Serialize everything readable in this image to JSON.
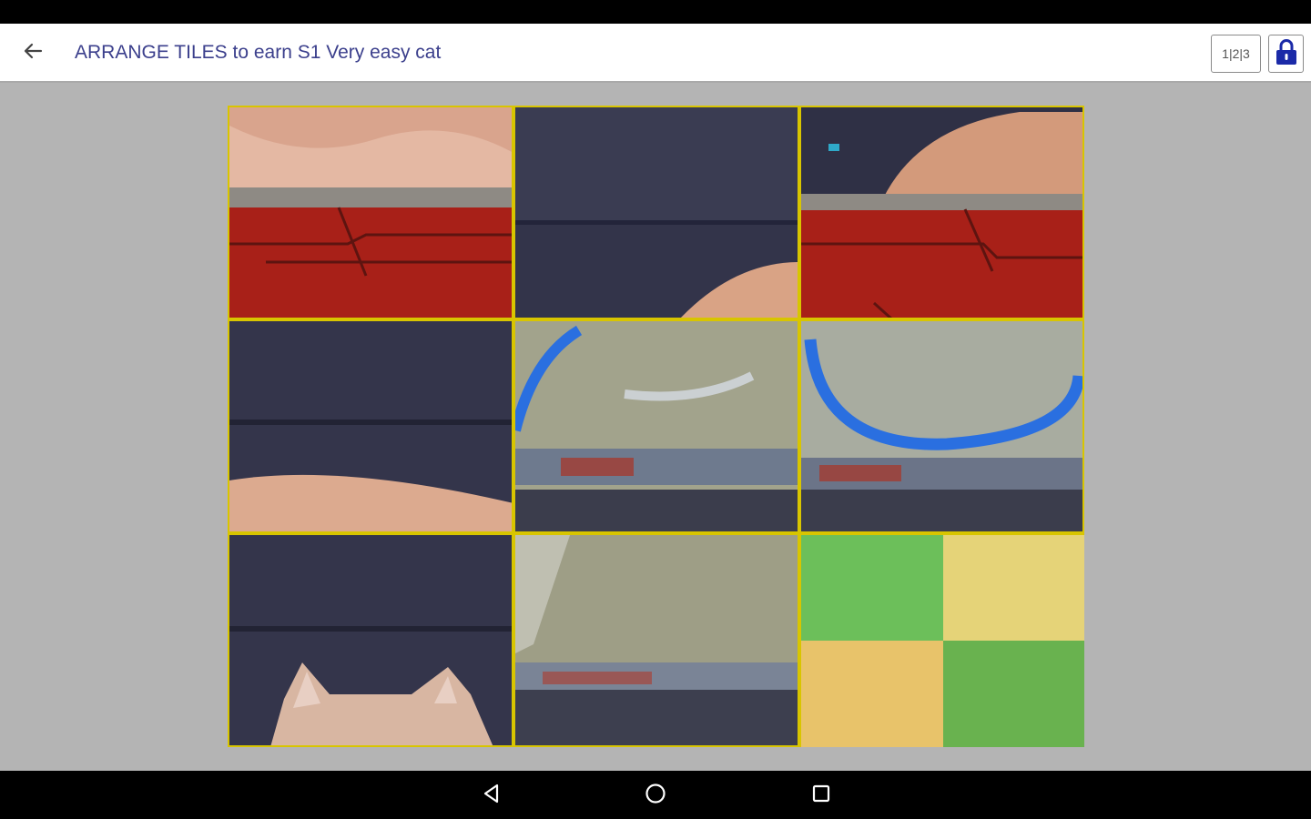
{
  "app_bar": {
    "title": "ARRANGE TILES to earn S1 Very easy cat",
    "mode_label": "1|2|3",
    "back_icon": "arrow-left-icon",
    "lock_icon": "lock-icon"
  },
  "colors": {
    "title_text": "#3b3f8c",
    "board_border": "#d8c500",
    "background": "#b4b4b4",
    "lock_accent": "#1b2aa8"
  },
  "board": {
    "rows": 3,
    "cols": 3,
    "tiles": [
      {
        "content": "cat-fur-on-red-brick"
      },
      {
        "content": "dark-slate-wall-with-tail"
      },
      {
        "content": "cat-body-on-red-brick"
      },
      {
        "content": "dark-slate-wall-with-cat-back"
      },
      {
        "content": "concrete-blue-graffiti"
      },
      {
        "content": "concrete-blue-loop-graffiti"
      },
      {
        "content": "dark-wall-with-cat-ears"
      },
      {
        "content": "plain-concrete-wall"
      },
      {
        "content": "empty-slot-color-quadrants"
      }
    ]
  },
  "nav_bar": {
    "icons": [
      "back-triangle-icon",
      "home-circle-icon",
      "recents-square-icon"
    ]
  }
}
